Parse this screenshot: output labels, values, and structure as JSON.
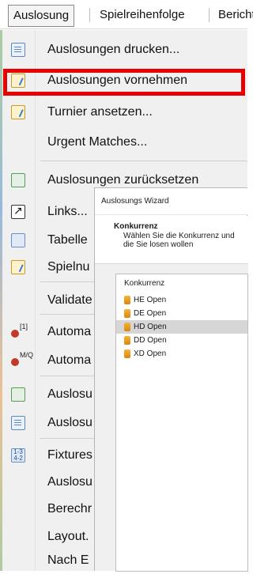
{
  "menubar": {
    "items": [
      {
        "label": "Auslosung",
        "active": true
      },
      {
        "label": "Spielreihenfolge",
        "active": false
      },
      {
        "label": "Berichte",
        "active": false
      }
    ]
  },
  "menu": {
    "items": [
      {
        "label": "Auslosungen drucken...",
        "icon": "document-print-icon"
      },
      {
        "label": "Auslosungen vornehmen",
        "icon": "draw-bracket-icon",
        "highlighted": true
      },
      {
        "label": "Turnier ansetzen...",
        "icon": "schedule-tournament-icon"
      },
      {
        "label": "Urgent Matches...",
        "icon": ""
      },
      {
        "label": "Auslosungen zurücksetzen",
        "icon": "reset-draws-icon"
      },
      {
        "label": "Links...",
        "icon": "link-arrow-icon"
      },
      {
        "label": "Tabelle",
        "icon": "table-icon"
      },
      {
        "label": "Spielnu",
        "icon": "match-number-icon"
      },
      {
        "label": "Validate",
        "icon": ""
      },
      {
        "label": "Automa",
        "icon": "auto-seed-icon",
        "icon_text": "[1]"
      },
      {
        "label": "Automa",
        "icon": "auto-qualifier-icon",
        "icon_text": "M/Q"
      },
      {
        "label": "Auslosu",
        "icon": "draw-add-icon"
      },
      {
        "label": "Auslosu",
        "icon": "draw-copy-icon"
      },
      {
        "label": "Fixtures",
        "icon": "fixtures-icon",
        "icon_text": "1-3 4-2"
      },
      {
        "label": "Auslosu",
        "icon": ""
      },
      {
        "label": "Berechr",
        "icon": ""
      },
      {
        "label": "Layout.",
        "icon": ""
      },
      {
        "label": "Nach E",
        "icon": ""
      }
    ]
  },
  "wizard": {
    "title": "Auslosungs Wizard",
    "heading": "Konkurrenz",
    "subheading": "Wählen Sie die Konkurrenz und die Sie losen wollen",
    "list_header": "Konkurrenz",
    "events": [
      {
        "label": "HE Open",
        "selected": false
      },
      {
        "label": "DE Open",
        "selected": false
      },
      {
        "label": "HD Open",
        "selected": true
      },
      {
        "label": "DD Open",
        "selected": false
      },
      {
        "label": "XD Open",
        "selected": false
      }
    ]
  },
  "colors": {
    "highlight_border": "#e60000",
    "menu_background": "#f0f0f0",
    "selected_row": "#d6d6d6"
  }
}
